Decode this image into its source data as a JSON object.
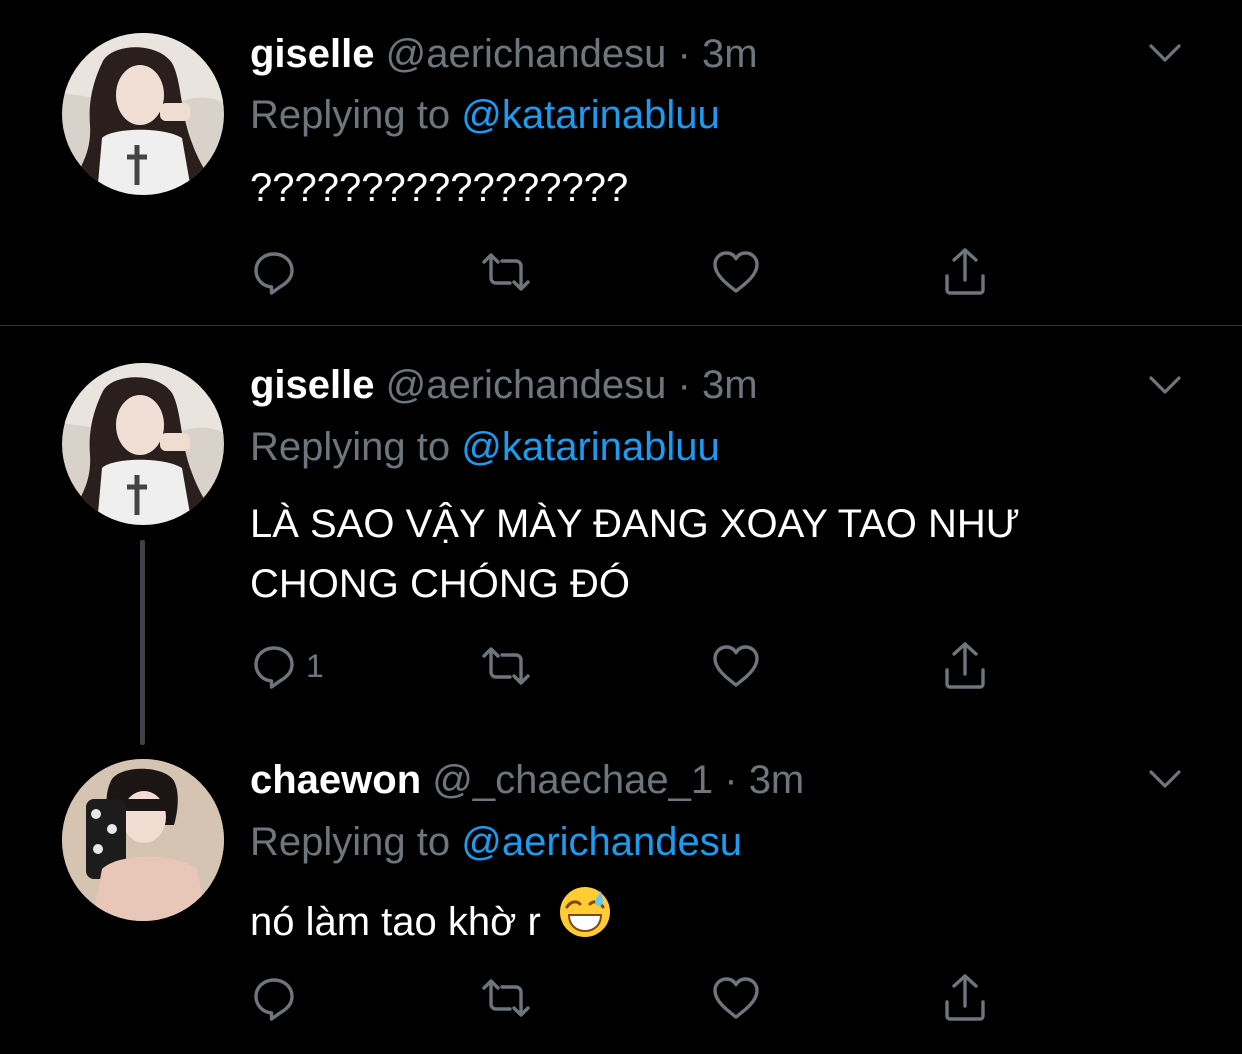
{
  "tweets": [
    {
      "name": "giselle",
      "handle": "@aerichandesu",
      "dot": "·",
      "time": "3m",
      "replying_prefix": "Replying to",
      "replying_handle": "@katarinabluu",
      "text_lines": [
        "?????????????????"
      ],
      "reply_count": "",
      "icons": [
        "reply-icon",
        "retweet-icon",
        "like-icon",
        "share-icon",
        "chevron-down-icon"
      ]
    },
    {
      "name": "giselle",
      "handle": "@aerichandesu",
      "dot": "·",
      "time": "3m",
      "replying_prefix": "Replying to",
      "replying_handle": "@katarinabluu",
      "text_lines": [
        "LÀ SAO VẬY MÀY ĐANG XOAY TAO NHƯ",
        "CHONG CHÓNG ĐÓ"
      ],
      "reply_count": "1",
      "icons": [
        "reply-icon",
        "retweet-icon",
        "like-icon",
        "share-icon",
        "chevron-down-icon"
      ]
    },
    {
      "name": "chaewon",
      "handle": "@_chaechae_1",
      "dot": "·",
      "time": "3m",
      "replying_prefix": "Replying to",
      "replying_handle": "@aerichandesu",
      "text_lines": [
        "nó làm tao khờ r"
      ],
      "emoji": "grinning-face-with-sweat-emoji",
      "reply_count": "",
      "icons": [
        "reply-icon",
        "retweet-icon",
        "like-icon",
        "share-icon",
        "chevron-down-icon"
      ]
    }
  ],
  "colors": {
    "background": "#000000",
    "primary_text": "#ffffff",
    "secondary_text": "#6e767d",
    "link": "#1d9bf0",
    "divider": "#2f3336"
  }
}
